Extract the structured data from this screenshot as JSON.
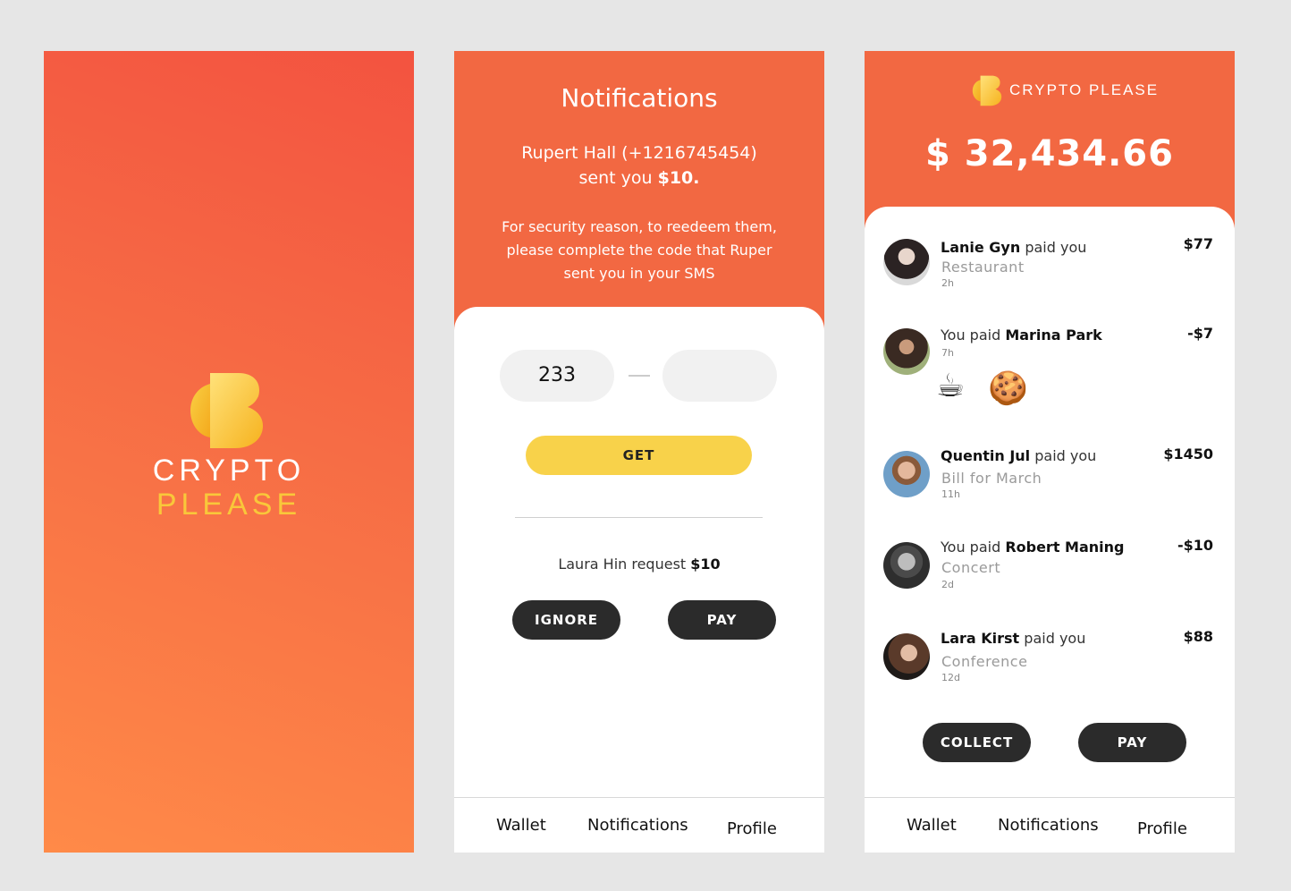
{
  "splash": {
    "brand_line1": "CRYPTO",
    "brand_line2": "PLEASE"
  },
  "notifications": {
    "title": "Notifications",
    "message_line1": "Rupert Hall (+1216745454)",
    "message_prefix": "sent you ",
    "message_amount": "$10.",
    "security_note": "For security reason, to reedeem them, please complete the code  that Ruper sent you in  your SMS",
    "code_part1": "233",
    "code_part2": "",
    "get_label": "GET",
    "request_prefix": "Laura Hin request ",
    "request_amount": "$10",
    "ignore_label": "IGNORE",
    "pay_label": "PAY"
  },
  "wallet": {
    "logo_text": "CRYPTO PLEASE",
    "balance": "$ 32,434.66",
    "transactions": [
      {
        "name": "Lanie Gyn",
        "action": " paid you",
        "prefix": "",
        "note": "Restaurant",
        "time": "2h",
        "amount": "$77"
      },
      {
        "name": "Marina Park",
        "action": "",
        "prefix": "You paid ",
        "note": "",
        "time": "7h",
        "amount": "-$7",
        "emojis": [
          "☕",
          "🍪"
        ]
      },
      {
        "name": "Quentin Jul",
        "action": " paid you",
        "prefix": "",
        "note": "Bill for March",
        "time": "11h",
        "amount": "$1450"
      },
      {
        "name": "Robert Maning",
        "action": "",
        "prefix": "You paid ",
        "note": "Concert",
        "time": "2d",
        "amount": "-$10"
      },
      {
        "name": "Lara Kirst",
        "action": " paid you",
        "prefix": "",
        "note": "Conference",
        "time": "12d",
        "amount": "$88"
      }
    ],
    "collect_label": "COLLECT",
    "pay_label": "PAY"
  },
  "tabs": {
    "wallet": "Wallet",
    "notifications": "Notifications",
    "profile": "Profile"
  },
  "colors": {
    "accent_orange": "#f26842",
    "brand_yellow": "#f9c73a",
    "button_dark": "#2b2b2b",
    "button_yellow": "#f8d24a"
  }
}
